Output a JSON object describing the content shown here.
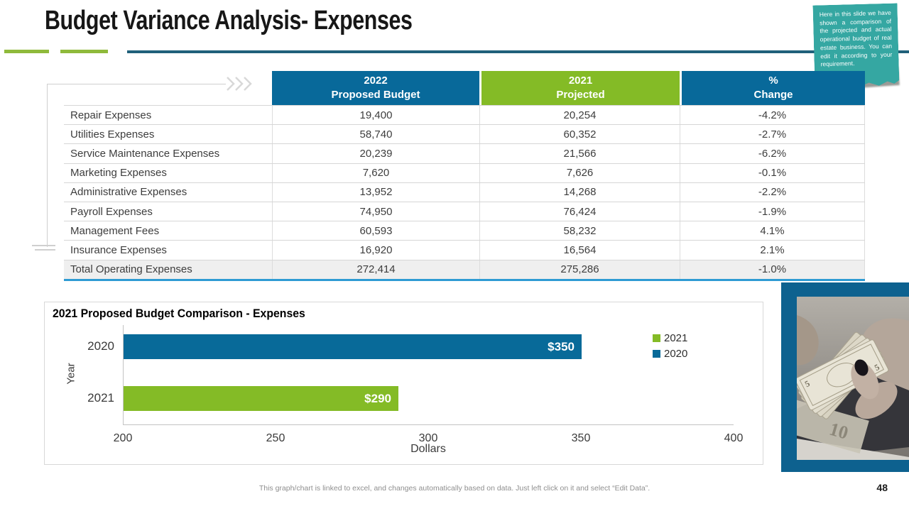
{
  "slide": {
    "title": "Budget Variance Analysis- Expenses",
    "page_number": "48",
    "footer": "This graph/chart is linked to excel, and changes automatically based on data. Just left click on it and select “Edit Data”."
  },
  "note": {
    "text": "Here in this slide we have shown a comparison of the projected and actual operational budget of real estate business. You can edit it according to your requirement."
  },
  "table": {
    "header": [
      {
        "line1": "2022",
        "line2": "Proposed Budget"
      },
      {
        "line1": "2021",
        "line2": "Projected"
      },
      {
        "line1": "%",
        "line2": "Change"
      }
    ],
    "rows": [
      [
        "Repair Expenses",
        "19,400",
        "20,254",
        "-4.2%"
      ],
      [
        "Utilities Expenses",
        "58,740",
        "60,352",
        "-2.7%"
      ],
      [
        "Service Maintenance Expenses",
        "20,239",
        "21,566",
        "-6.2%"
      ],
      [
        "Marketing Expenses",
        "7,620",
        "7,626",
        "-0.1%"
      ],
      [
        "Administrative Expenses",
        "13,952",
        "14,268",
        "-2.2%"
      ],
      [
        "Payroll Expenses",
        "74,950",
        "76,424",
        "-1.9%"
      ],
      [
        "Management Fees",
        "60,593",
        "58,232",
        "4.1%"
      ],
      [
        "Insurance Expenses",
        "16,920",
        "16,564",
        "2.1%"
      ]
    ],
    "total_row": [
      "Total Operating Expenses",
      "272,414",
      "275,286",
      "-1.0%"
    ]
  },
  "chart_data": {
    "type": "bar",
    "orientation": "horizontal",
    "title": "2021 Proposed Budget Comparison - Expenses",
    "categories": [
      "2020",
      "2021"
    ],
    "values": [
      350,
      290
    ],
    "data_labels": [
      "$350",
      "$290"
    ],
    "series_colors": [
      "#086A99",
      "#84BB26"
    ],
    "legend": [
      {
        "label": "2021",
        "color": "#84BB26"
      },
      {
        "label": "2020",
        "color": "#086A99"
      }
    ],
    "legend_position": "right",
    "xlabel": "Dollars",
    "ylabel": "Year",
    "xlim": [
      200,
      400
    ],
    "xticks": [
      "200",
      "250",
      "300",
      "350",
      "400"
    ],
    "grid": false
  },
  "colors": {
    "accent_blue": "#08699A",
    "accent_green": "#84BB26",
    "note_teal": "#35A7A2",
    "panel_blue": "#0D618F",
    "table_bottom_border": "#2E9BD3"
  }
}
